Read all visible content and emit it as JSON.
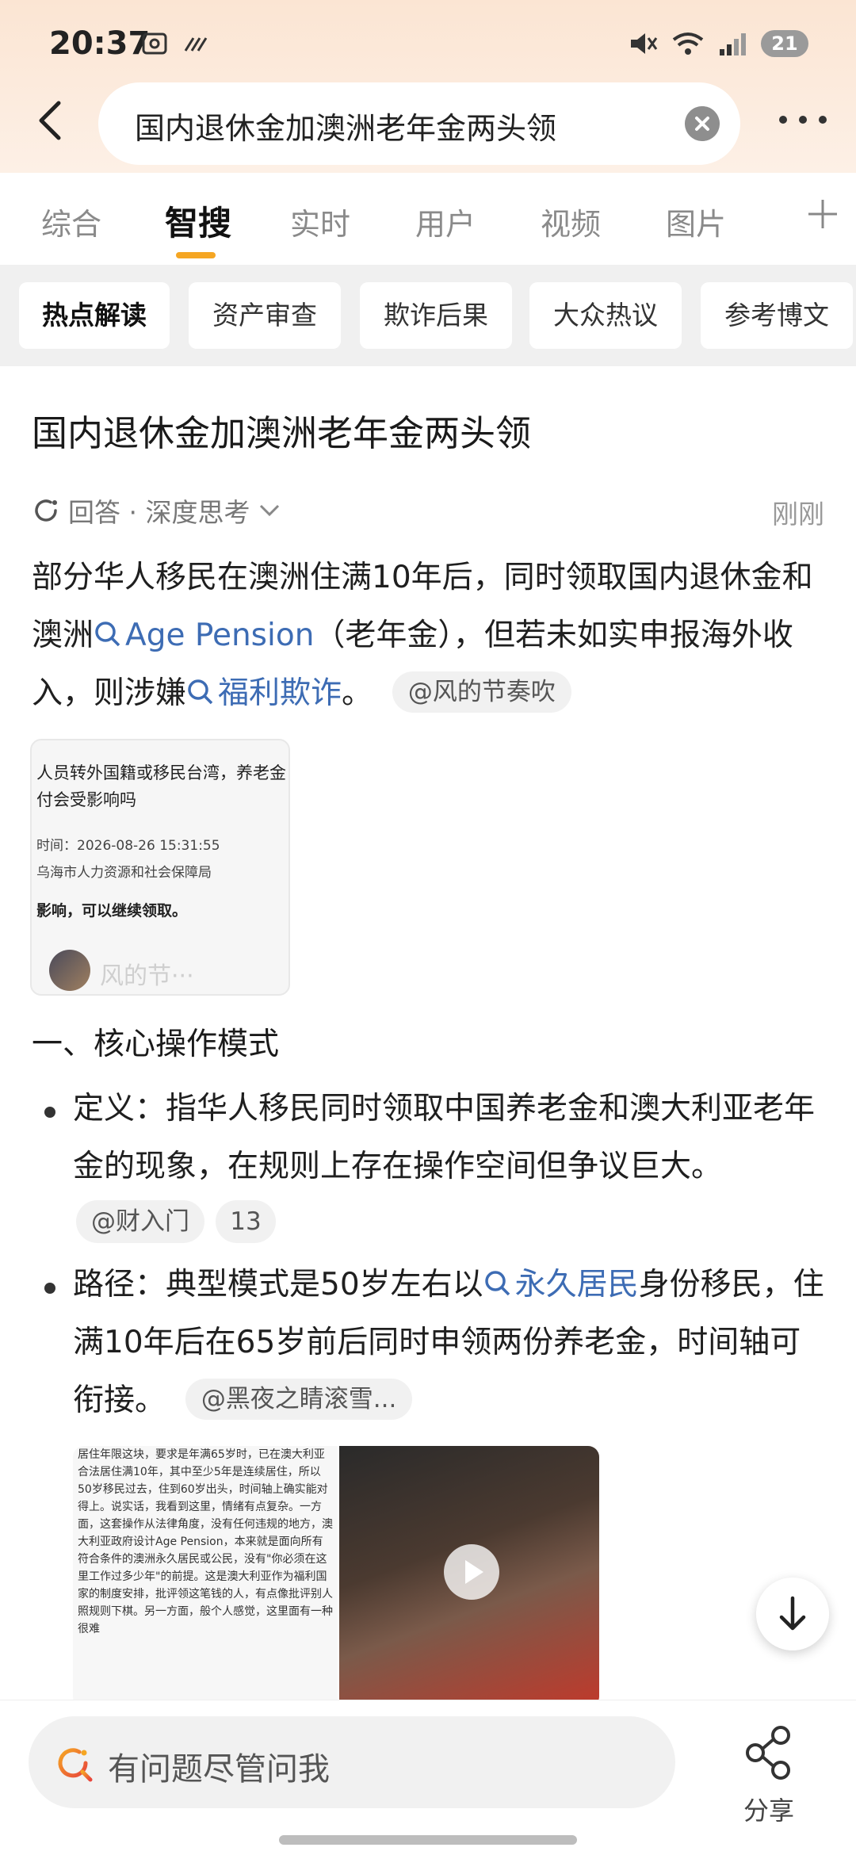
{
  "status_bar": {
    "time": "20:37",
    "battery": "21",
    "icons": [
      "screenshot-icon",
      "signal-slash-icon",
      "mute-icon",
      "wifi-icon",
      "cell-signal-icon",
      "battery-icon"
    ]
  },
  "search": {
    "query": "国内退休金加澳洲老年金两头领"
  },
  "tabs": [
    {
      "label": "综合"
    },
    {
      "label": "智搜"
    },
    {
      "label": "实时"
    },
    {
      "label": "用户"
    },
    {
      "label": "视频"
    },
    {
      "label": "图片"
    }
  ],
  "active_tab": "智搜",
  "chips": [
    {
      "label": "热点解读"
    },
    {
      "label": "资产审查"
    },
    {
      "label": "欺诈后果"
    },
    {
      "label": "大众热议"
    },
    {
      "label": "参考博文"
    }
  ],
  "answer": {
    "title": "国内退休金加澳洲老年金两头领",
    "meta_label": "回答 · 深度思考",
    "timestamp": "刚刚",
    "intro": {
      "p1": "部分华人移民在澳洲住满10年后，同时领取国内退休金和澳洲",
      "link1": "Age Pension",
      "p2": "（老年金），但若未如实申报海外收入，则涉嫌",
      "link2": "福利欺诈",
      "p3": "。",
      "cite": "@风的节奏吹"
    },
    "thumb1": {
      "line1": "人员转外国籍或移民台湾，养老金付会受影响吗",
      "line2": "时间：2026-08-26 15:31:55",
      "line3": "乌海市人力资源和社会保障局",
      "line4": "影响，可以继续领取。",
      "author": "风的节···"
    },
    "section1_title": "一、核心操作模式",
    "bullet1": {
      "text": "定义：指华人移民同时领取中国养老金和澳大利亚老年金的现象，在规则上存在操作空间但争议巨大。",
      "cite": "@财入门",
      "count": "13"
    },
    "bullet2": {
      "p1": "路径：典型模式是50岁左右以",
      "link": "永久居民",
      "p2": "身份移民，住满10年后在65岁前后同时申领两份养老金，时间轴可衔接。",
      "cite": "@黑夜之睛滚雪..."
    },
    "image_left_text": "居住年限这块，要求是年满65岁时，已在澳大利亚合法居住满10年，其中至少5年是连续居住，所以50岁移民过去，住到60岁出头，时间轴上确实能对得上。说实话，我看到这里，情绪有点复杂。一方面，这套操作从法律角度，没有任何违规的地方，澳大利亚政府设计Age Pension，本来就是面向所有符合条件的澳洲永久居民或公民，没有\"你必须在这里工作过多少年\"的前提。这是澳大利亚作为福利国家的制度安排，批评领这笔钱的人，有点像批评别人照规则下棋。另一方面，般个人感觉，这里面有一种很难"
  },
  "bottom_bar": {
    "ask_placeholder": "有问题尽管问我",
    "share_label": "分享"
  },
  "colors": {
    "accent": "#f5a623",
    "link": "#3d6cb4",
    "header_bg": "#fbe5d3"
  }
}
